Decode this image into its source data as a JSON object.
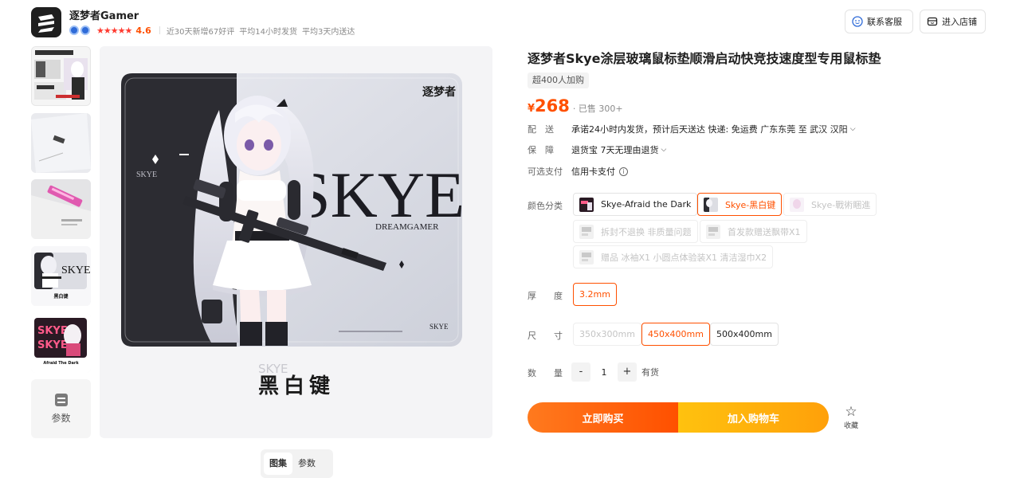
{
  "shop": {
    "name": "逐梦者Gamer",
    "rating": "4.6",
    "stars": "★★★★★",
    "stats": [
      "近30天新增67好评",
      "平均14小时发货",
      "平均3天内送达"
    ],
    "service_button": "联系客服",
    "store_button": "进入店铺"
  },
  "gallery": {
    "thumbnails": [
      {
        "name": "thumb-1",
        "caption": "特殊涂层玻璃垫"
      },
      {
        "name": "thumb-2",
        "caption": ""
      },
      {
        "name": "thumb-3",
        "caption": ""
      },
      {
        "name": "thumb-4",
        "caption": "黑白键"
      },
      {
        "name": "thumb-5",
        "caption": "Afraid The Dark"
      }
    ],
    "params_thumb_label": "参数",
    "main_caption_small": "SKYE",
    "main_caption_big": "黑白键",
    "pad_brand": "逐梦者",
    "pad_big_text": "SKYE",
    "pad_sub_text": "DREAMGAMER",
    "pad_side_text": "SKYE",
    "pad_corner_text": "SKYE",
    "tabs": [
      "图集",
      "参数"
    ],
    "active_tab": "图集"
  },
  "product": {
    "title": "逐梦者Skye涂层玻璃鼠标垫顺滑启动快竞技速度型专用鼠标垫",
    "cart_pill": "超400人加购",
    "price_symbol": "¥",
    "price": "268",
    "sold": "· 已售 300+",
    "delivery_label": "配送",
    "delivery_value": "承诺24小时内发货，预计后天送达  快递: 免运费  广东东莞  至  武汉 汉阳",
    "guarantee_label": "保障",
    "guarantee_value": "退货宝  7天无理由退货",
    "payment_label": "可选支付",
    "payment_value": "信用卡支付",
    "color_label": "颜色分类",
    "colors": [
      {
        "label": "Skye-Afraid the Dark",
        "state": "normal"
      },
      {
        "label": "Skye-黑白键",
        "state": "selected"
      },
      {
        "label": "Skye-戰術睏進",
        "state": "disabled"
      },
      {
        "label": "拆封不退换 非质量问题",
        "state": "disabled"
      },
      {
        "label": "首发款赠送飘带X1",
        "state": "disabled"
      },
      {
        "label": "赠品 冰袖X1 小圆点体验装X1 清洁湿巾X2",
        "state": "disabled"
      }
    ],
    "thickness_label": "厚度",
    "thickness_options": [
      "3.2mm"
    ],
    "size_label": "尺寸",
    "sizes": [
      {
        "label": "350x300mm",
        "state": "disabled"
      },
      {
        "label": "450x400mm",
        "state": "selected"
      },
      {
        "label": "500x400mm",
        "state": "normal"
      }
    ],
    "qty_label": "数量",
    "quantity": "1",
    "stock": "有货",
    "buy_now": "立即购买",
    "add_to_cart": "加入购物车",
    "favorite": "收藏"
  },
  "colors": {
    "accent": "#ff5000",
    "buy_gradient_start": "#ff7a1e",
    "cart_gradient_start": "#ffc20e"
  }
}
